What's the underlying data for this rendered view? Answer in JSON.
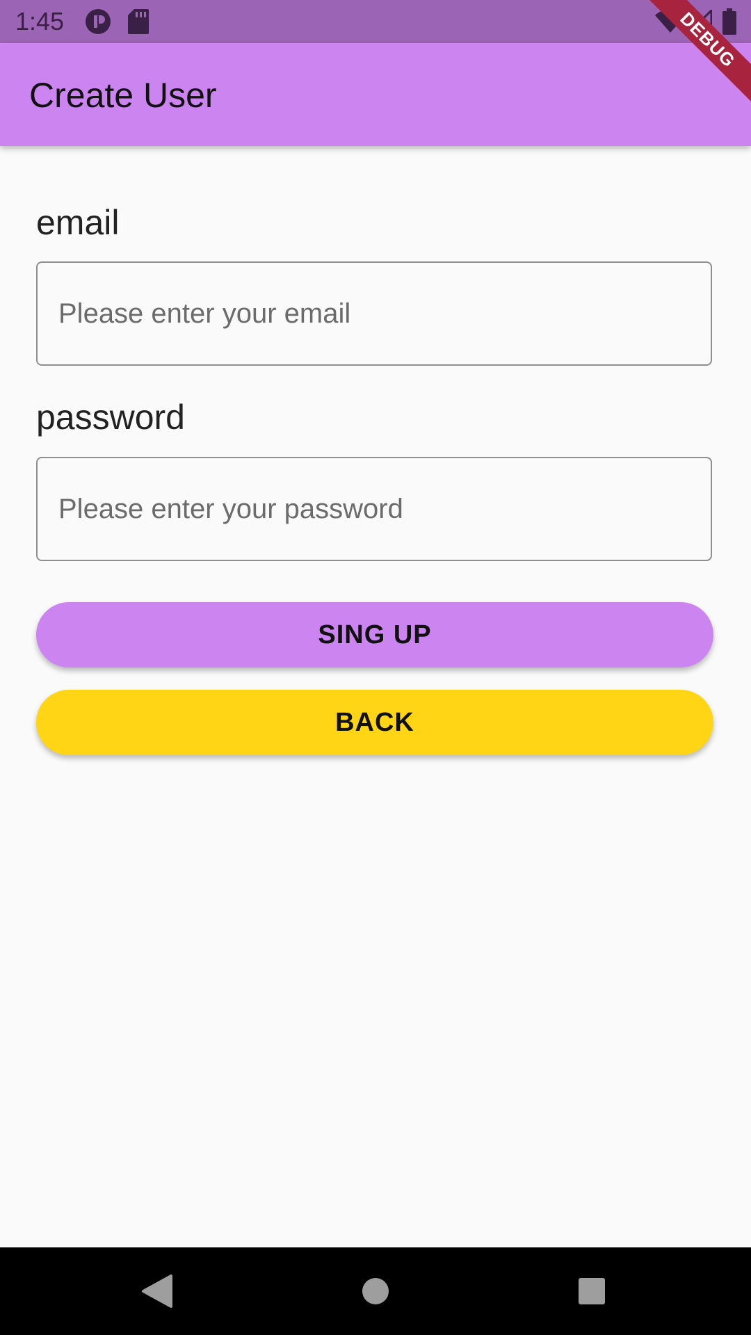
{
  "status_bar": {
    "time": "1:45",
    "background": "#9c64b5"
  },
  "debug_banner": {
    "label": "DEBUG"
  },
  "app_bar": {
    "title": "Create User",
    "background": "#cc84f0"
  },
  "form": {
    "email": {
      "label": "email",
      "placeholder": "Please enter your email",
      "value": ""
    },
    "password": {
      "label": "password",
      "placeholder": "Please enter your password",
      "value": ""
    }
  },
  "buttons": {
    "signup_label": "SING UP",
    "signup_color": "#cc84f0",
    "back_label": "BACK",
    "back_color": "#ffd515"
  },
  "nav_bar": {
    "icons": [
      "back-triangle-icon",
      "home-circle-icon",
      "recents-square-icon"
    ]
  }
}
